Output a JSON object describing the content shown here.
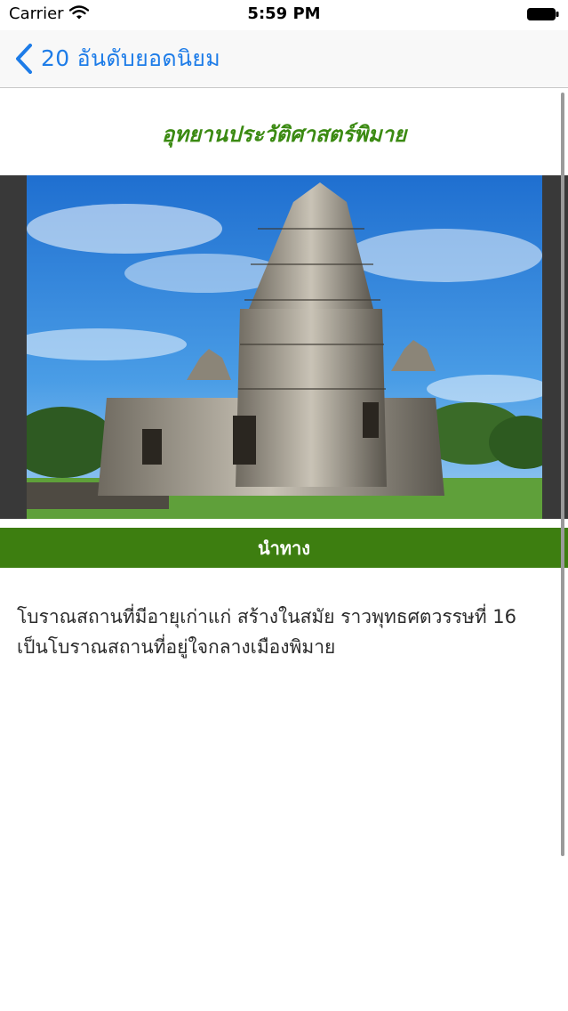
{
  "status_bar": {
    "carrier": "Carrier",
    "time": "5:59 PM",
    "icons": [
      "wifi-icon",
      "battery-icon"
    ]
  },
  "nav": {
    "back_label": "20 อันดับยอดนิยม",
    "back_icon": "chevron-left-icon",
    "tint_color": "#1d7ce8"
  },
  "main": {
    "title": "อุทยานประวัติศาสตร์พิมาย",
    "title_color": "#3b8a12",
    "image_subject": "phimai-temple-photo",
    "action_button_label": "นำทาง",
    "action_button_color": "#3d7e10",
    "description": "โบราณสถานที่มีอายุเก่าแก่ สร้างในสมัย ราวพุทธศตวรรษที่ 16 เป็นโบราณสถานที่อยู่ใจกลางเมืองพิมาย"
  }
}
